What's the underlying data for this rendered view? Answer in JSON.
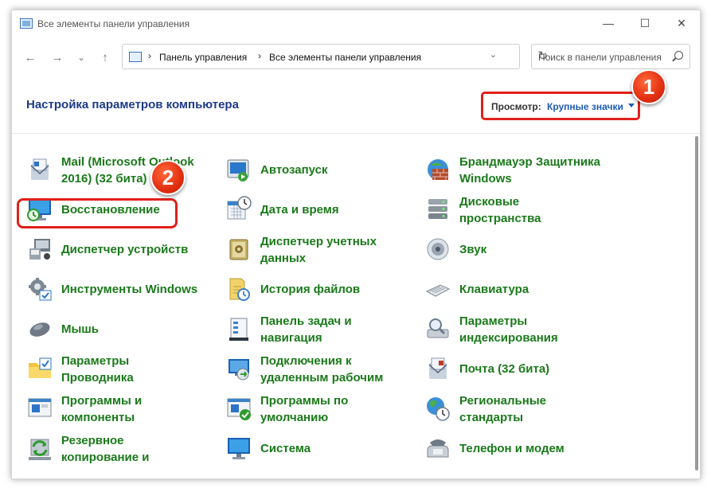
{
  "window": {
    "title": "Все элементы панели управления"
  },
  "window_controls": {
    "minimize": "—",
    "maximize": "☐",
    "close": "✕"
  },
  "nav": {
    "back": "←",
    "forward": "→",
    "recent": "⌄",
    "up": "↑"
  },
  "address": {
    "crumbs": [
      "Панель управления",
      "Все элементы панели управления"
    ],
    "separator": "›"
  },
  "search": {
    "placeholder": "Поиск в панели управления"
  },
  "header": {
    "title": "Настройка параметров компьютера",
    "view_label": "Просмотр:",
    "view_value": "Крупные значки"
  },
  "badges": [
    "1",
    "2"
  ],
  "items": [
    {
      "lines": [
        "Mail (Microsoft Outlook",
        "2016) (32 бита)"
      ],
      "icon": "mail-icon"
    },
    {
      "lines": [
        "Автозапуск"
      ],
      "icon": "autoplay-icon"
    },
    {
      "lines": [
        "Брандмауэр Защитника",
        "Windows"
      ],
      "icon": "firewall-icon"
    },
    {
      "lines": [
        "Восстановление"
      ],
      "icon": "recovery-icon"
    },
    {
      "lines": [
        "Дата и время"
      ],
      "icon": "calendar-clock-icon"
    },
    {
      "lines": [
        "Дисковые",
        "пространства"
      ],
      "icon": "storage-spaces-icon"
    },
    {
      "lines": [
        "Диспетчер устройств"
      ],
      "icon": "device-manager-icon"
    },
    {
      "lines": [
        "Диспетчер учетных",
        "данных"
      ],
      "icon": "credential-vault-icon"
    },
    {
      "lines": [
        "Звук"
      ],
      "icon": "speaker-icon"
    },
    {
      "lines": [
        "Инструменты Windows"
      ],
      "icon": "windows-tools-icon"
    },
    {
      "lines": [
        "История файлов"
      ],
      "icon": "file-history-icon"
    },
    {
      "lines": [
        "Клавиатура"
      ],
      "icon": "keyboard-icon"
    },
    {
      "lines": [
        "Мышь"
      ],
      "icon": "mouse-icon"
    },
    {
      "lines": [
        "Панель задач и",
        "навигация"
      ],
      "icon": "taskbar-icon"
    },
    {
      "lines": [
        "Параметры",
        "индексирования"
      ],
      "icon": "indexing-icon"
    },
    {
      "lines": [
        "Параметры",
        "Проводника"
      ],
      "icon": "explorer-options-icon"
    },
    {
      "lines": [
        "Подключения к",
        "удаленным рабочим"
      ],
      "icon": "remote-desktop-icon"
    },
    {
      "lines": [
        "Почта (32 бита)"
      ],
      "icon": "mail-32-icon"
    },
    {
      "lines": [
        "Программы и",
        "компоненты"
      ],
      "icon": "programs-icon"
    },
    {
      "lines": [
        "Программы по",
        "умолчанию"
      ],
      "icon": "default-programs-icon"
    },
    {
      "lines": [
        "Региональные",
        "стандарты"
      ],
      "icon": "region-icon"
    },
    {
      "lines": [
        "Резервное",
        "копирование и"
      ],
      "icon": "backup-icon"
    },
    {
      "lines": [
        "Система"
      ],
      "icon": "system-icon"
    },
    {
      "lines": [
        "Телефон и модем"
      ],
      "icon": "phone-modem-icon"
    }
  ],
  "colors": {
    "link": "#1a7a1a",
    "heading": "#1e3a8a",
    "highlight": "#e0201a",
    "accent": "#1e5cb3"
  }
}
